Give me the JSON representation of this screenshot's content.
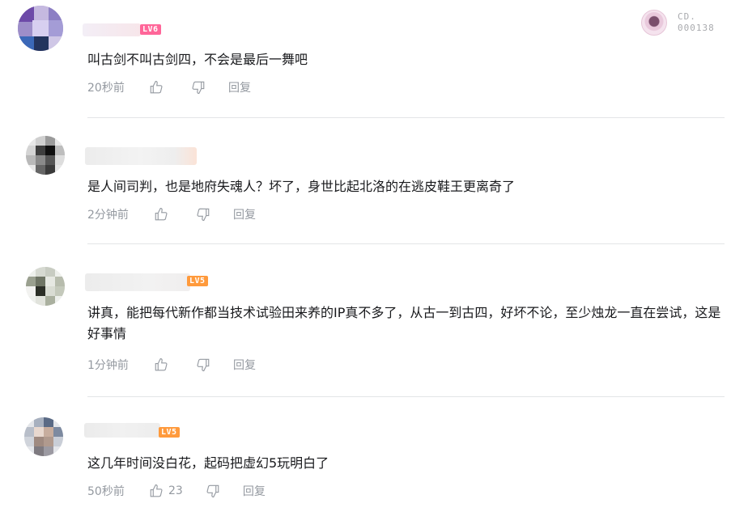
{
  "colors": {
    "text": "#18191c",
    "meta": "#9499a0",
    "divider": "#e3e5e7",
    "lv6": "#ff6699",
    "lv5": "#ff9a3c"
  },
  "fan_badge": {
    "line1": "CD.",
    "line2": "000138"
  },
  "comments": [
    {
      "level": "LV6",
      "text": "叫古剑不叫古剑四，不会是最后一舞吧",
      "time": "20秒前",
      "like_count": "",
      "like_icon": "thumb-up-icon",
      "dislike_icon": "thumb-down-icon",
      "reply": "回复"
    },
    {
      "level": "",
      "text": "是人间司判，也是地府失魂人？坏了，身世比起北洛的在逃皮鞋王更离奇了",
      "time": "2分钟前",
      "like_count": "",
      "reply": "回复"
    },
    {
      "level": "LV5",
      "text": "讲真，能把每代新作都当技术试验田来养的IP真不多了，从古一到古四，好坏不论，至少烛龙一直在尝试，这是好事情",
      "time": "1分钟前",
      "like_count": "",
      "reply": "回复"
    },
    {
      "level": "LV5",
      "text": "这几年时间没白花，起码把虚幻5玩明白了",
      "time": "50秒前",
      "like_count": "23",
      "reply": "回复"
    }
  ]
}
